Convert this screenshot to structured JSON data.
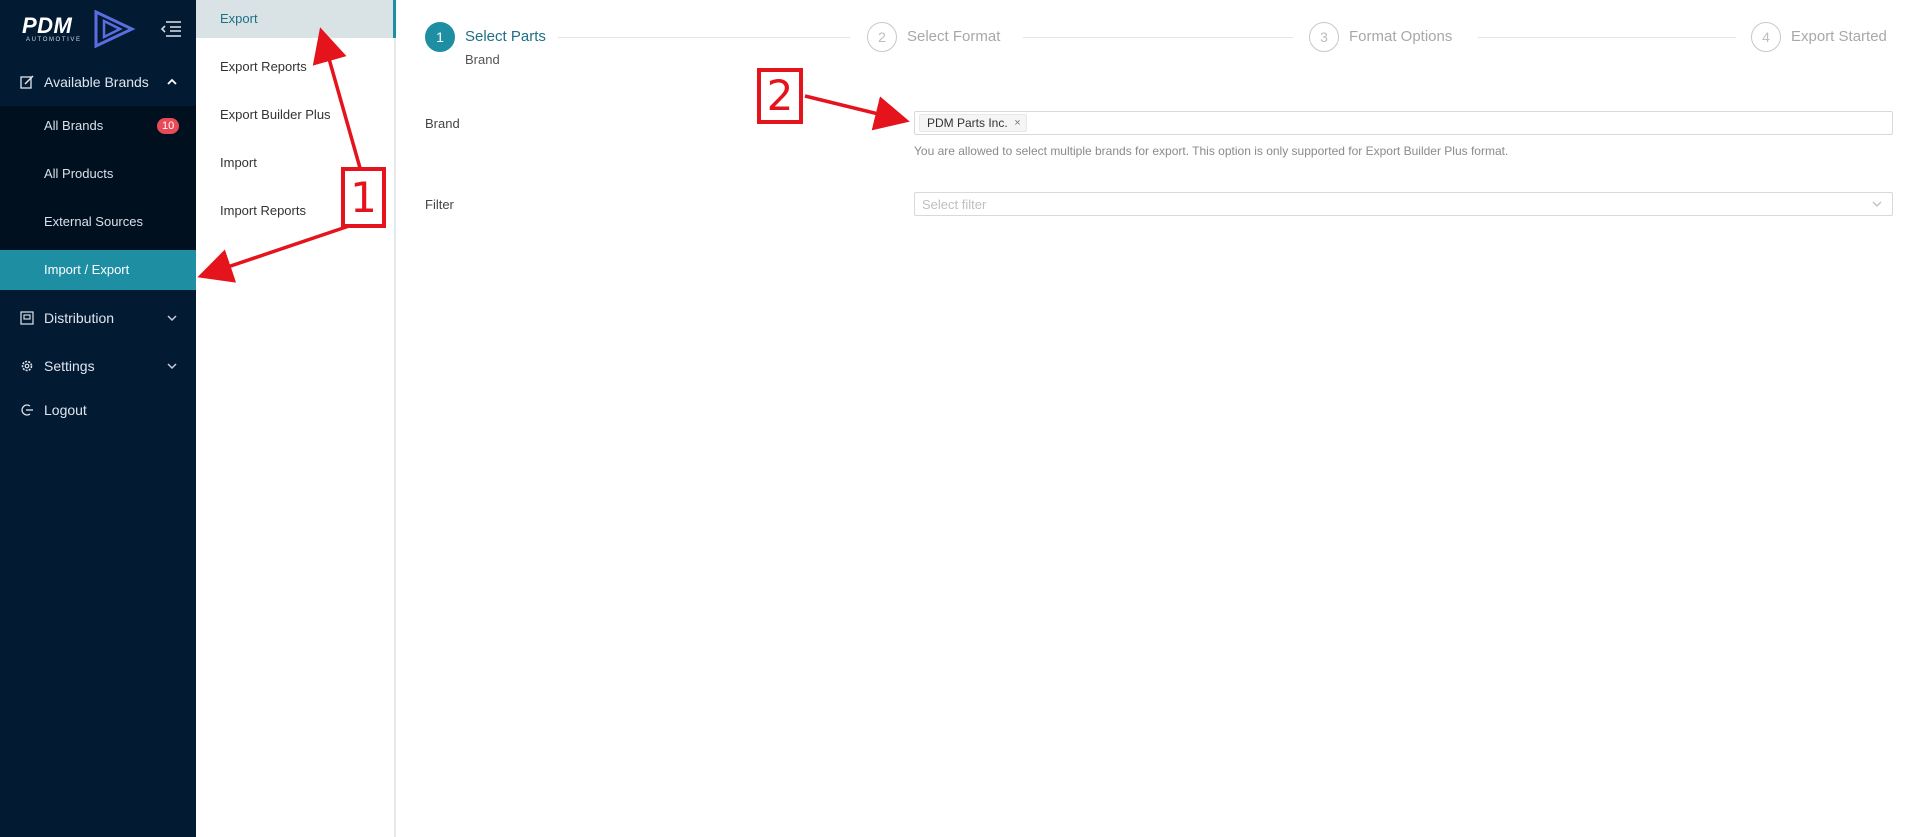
{
  "brand": {
    "logo_text": "PDM",
    "logo_sub": "AUTOMOTIVE"
  },
  "sidebar": {
    "items": [
      {
        "label": "Available Brands",
        "icon": "edit-icon",
        "expanded": true
      },
      {
        "label": "Distribution",
        "icon": "distribution-icon"
      },
      {
        "label": "Settings",
        "icon": "gear-icon"
      },
      {
        "label": "Logout",
        "icon": "logout-icon"
      }
    ],
    "subitems": [
      {
        "label": "All Brands",
        "badge": "10"
      },
      {
        "label": "All Products"
      },
      {
        "label": "External Sources"
      },
      {
        "label": "Import / Export",
        "active": true
      }
    ]
  },
  "submenu": {
    "items": [
      {
        "label": "Export",
        "active": true
      },
      {
        "label": "Export Reports"
      },
      {
        "label": "Export Builder Plus"
      },
      {
        "label": "Import"
      },
      {
        "label": "Import Reports"
      }
    ]
  },
  "steps": [
    {
      "number": "1",
      "title": "Select Parts",
      "desc": "Brand",
      "active": true
    },
    {
      "number": "2",
      "title": "Select Format"
    },
    {
      "number": "3",
      "title": "Format Options"
    },
    {
      "number": "4",
      "title": "Export Started"
    }
  ],
  "form": {
    "brand_label": "Brand",
    "brand_tag": "PDM Parts Inc.",
    "brand_tag_close": "×",
    "brand_help": "You are allowed to select multiple brands for export. This option is only supported for Export Builder Plus format.",
    "filter_label": "Filter",
    "filter_placeholder": "Select filter"
  },
  "annotations": {
    "marker1": "1",
    "marker2": "2"
  },
  "colors": {
    "sidebar_bg": "#031a33",
    "accent": "#1e8fa3",
    "badge": "#e84a57",
    "annotation": "#e5131b"
  }
}
